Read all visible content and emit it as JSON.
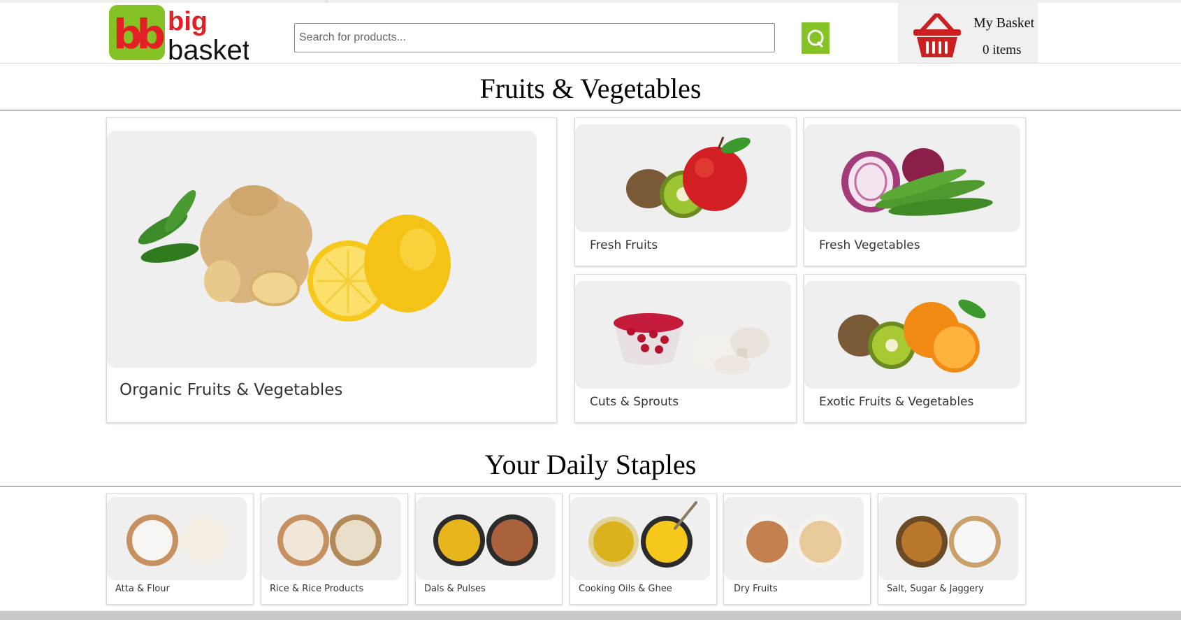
{
  "brand": {
    "logo_top": "big",
    "logo_bottom": "basket",
    "logo_mark": "bb",
    "green": "#84c225",
    "red": "#e31e25"
  },
  "search": {
    "placeholder": "Search for products...",
    "button_icon": "search-icon",
    "button_color": "#84c225"
  },
  "basket": {
    "title": "My Basket",
    "count_text": "0 items",
    "icon": "shopping-basket-icon",
    "icon_color": "#cc1f1f"
  },
  "sections": [
    {
      "title": "Fruits & Vegetables",
      "featured": {
        "label": "Organic Fruits & Vegetables"
      },
      "items": [
        {
          "label": "Fresh Fruits"
        },
        {
          "label": "Fresh Vegetables"
        },
        {
          "label": "Cuts & Sprouts"
        },
        {
          "label": "Exotic Fruits & Vegetables"
        }
      ]
    },
    {
      "title": "Your Daily Staples",
      "items": [
        {
          "label": "Atta & Flour"
        },
        {
          "label": "Rice & Rice Products"
        },
        {
          "label": "Dals & Pulses"
        },
        {
          "label": "Cooking Oils & Ghee"
        },
        {
          "label": "Dry Fruits"
        },
        {
          "label": "Salt, Sugar & Jaggery"
        }
      ]
    }
  ]
}
